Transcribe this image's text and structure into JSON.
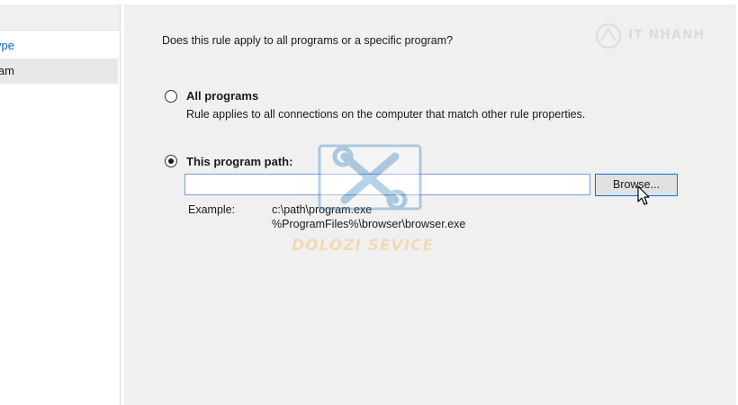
{
  "left_nav": {
    "steps": [
      {
        "label": "Rule Type"
      },
      {
        "label": "Program"
      }
    ]
  },
  "main": {
    "question": "Does this rule apply to all programs or a specific program?",
    "all_programs": {
      "label": "All programs",
      "description": "Rule applies to all connections on the computer that match other rule properties.",
      "selected": false
    },
    "program_path": {
      "label": "This program path:",
      "value": "",
      "selected": true
    },
    "browse_label": "Browse...",
    "example": {
      "label": "Example:",
      "lines": [
        "c:\\path\\program.exe",
        "%ProgramFiles%\\browser\\browser.exe"
      ]
    }
  },
  "watermarks": {
    "center_text": "DOLOZI SEVICE",
    "corner_text": "IT NHANH"
  },
  "colors": {
    "link": "#0066cc",
    "focus_border": "#0078d7",
    "panel_bg": "#f0f0f0"
  },
  "icons": {
    "cursor": "arrow-cursor-icon",
    "watermark_logo": "tools-icon"
  }
}
